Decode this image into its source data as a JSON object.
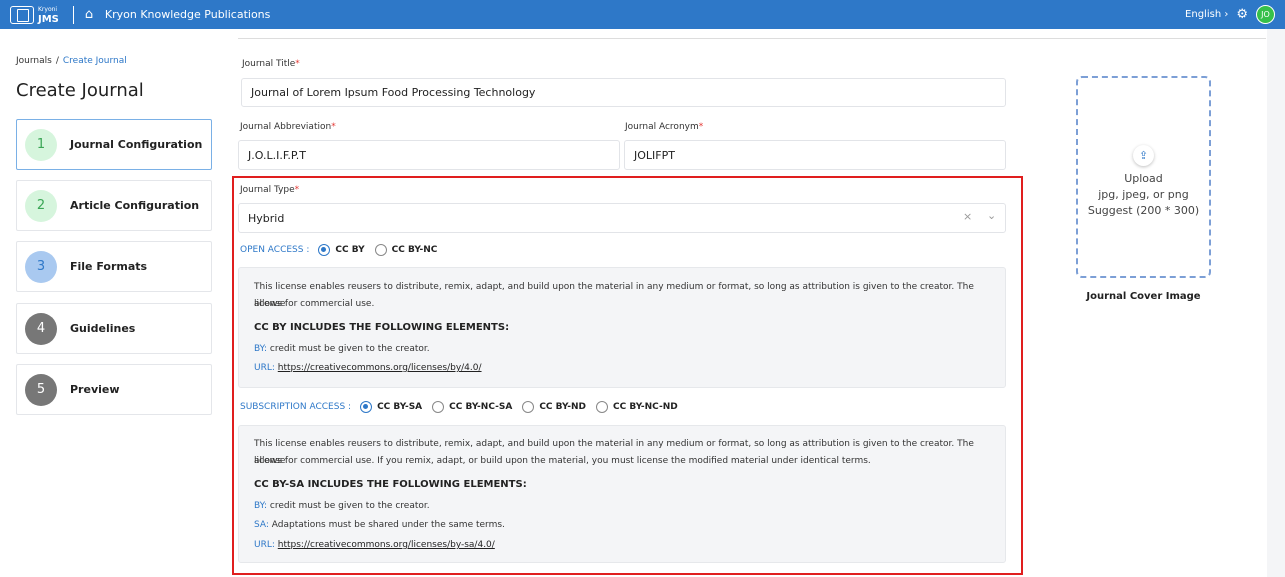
{
  "topbar": {
    "brand_small": "Kryoni",
    "brand_main": "JMS",
    "publication": "Kryon Knowledge Publications",
    "language": "English",
    "user_initials": "JO"
  },
  "breadcrumb": {
    "root": "Journals",
    "current": "Create Journal"
  },
  "page_title": "Create Journal",
  "steps": [
    {
      "num": "1",
      "label": "Journal Configuration"
    },
    {
      "num": "2",
      "label": "Article Configuration"
    },
    {
      "num": "3",
      "label": "File Formats"
    },
    {
      "num": "4",
      "label": "Guidelines"
    },
    {
      "num": "5",
      "label": "Preview"
    }
  ],
  "colors": {
    "accent": "#2e78c8",
    "step_done": "#d6f5dd",
    "step_active": "#a9c9f0",
    "step_pending": "#777777",
    "highlight": "#e01e1e"
  },
  "form": {
    "journal_title_label": "Journal Title",
    "journal_title_value": "Journal of Lorem Ipsum Food Processing Technology",
    "abbr_label": "Journal Abbreviation",
    "abbr_value": "J.O.L.I.F.P.T",
    "acronym_label": "Journal Acronym",
    "acronym_value": "JOLIFPT",
    "type_label": "Journal Type",
    "type_value": "Hybrid",
    "required_mark": "*"
  },
  "open_access": {
    "label": "OPEN ACCESS :",
    "options": [
      "CC BY",
      "CC BY-NC"
    ],
    "selected": "CC BY",
    "desc1": "This license enables reusers to distribute, remix, adapt, and build upon the material in any medium or format, so long as attribution is given to the creator. The license",
    "desc2": "allows for commercial use.",
    "heading": "CC BY INCLUDES THE FOLLOWING ELEMENTS:",
    "by_key": "BY:",
    "by_text": "credit must be given to the creator.",
    "url_key": "URL:",
    "url": "https://creativecommons.org/licenses/by/4.0/"
  },
  "subscription_access": {
    "label": "SUBSCRIPTION ACCESS :",
    "options": [
      "CC BY-SA",
      "CC BY-NC-SA",
      "CC BY-ND",
      "CC BY-NC-ND"
    ],
    "selected": "CC BY-SA",
    "desc1": "This license enables reusers to distribute, remix, adapt, and build upon the material in any medium or format, so long as attribution is given to the creator. The license",
    "desc2": "allows for commercial use. If you remix, adapt, or build upon the material, you must license the modified material under identical terms.",
    "heading": "CC BY-SA INCLUDES THE FOLLOWING ELEMENTS:",
    "by_key": "BY:",
    "by_text": "credit must be given to the creator.",
    "sa_key": "SA:",
    "sa_text": "Adaptations must be shared under the same terms.",
    "url_key": "URL:",
    "url": "https://creativecommons.org/licenses/by-sa/4.0/"
  },
  "upload": {
    "label": "Upload",
    "formats": "jpg, jpeg, or png",
    "suggest": "Suggest (200 * 300)",
    "caption": "Journal Cover Image"
  }
}
